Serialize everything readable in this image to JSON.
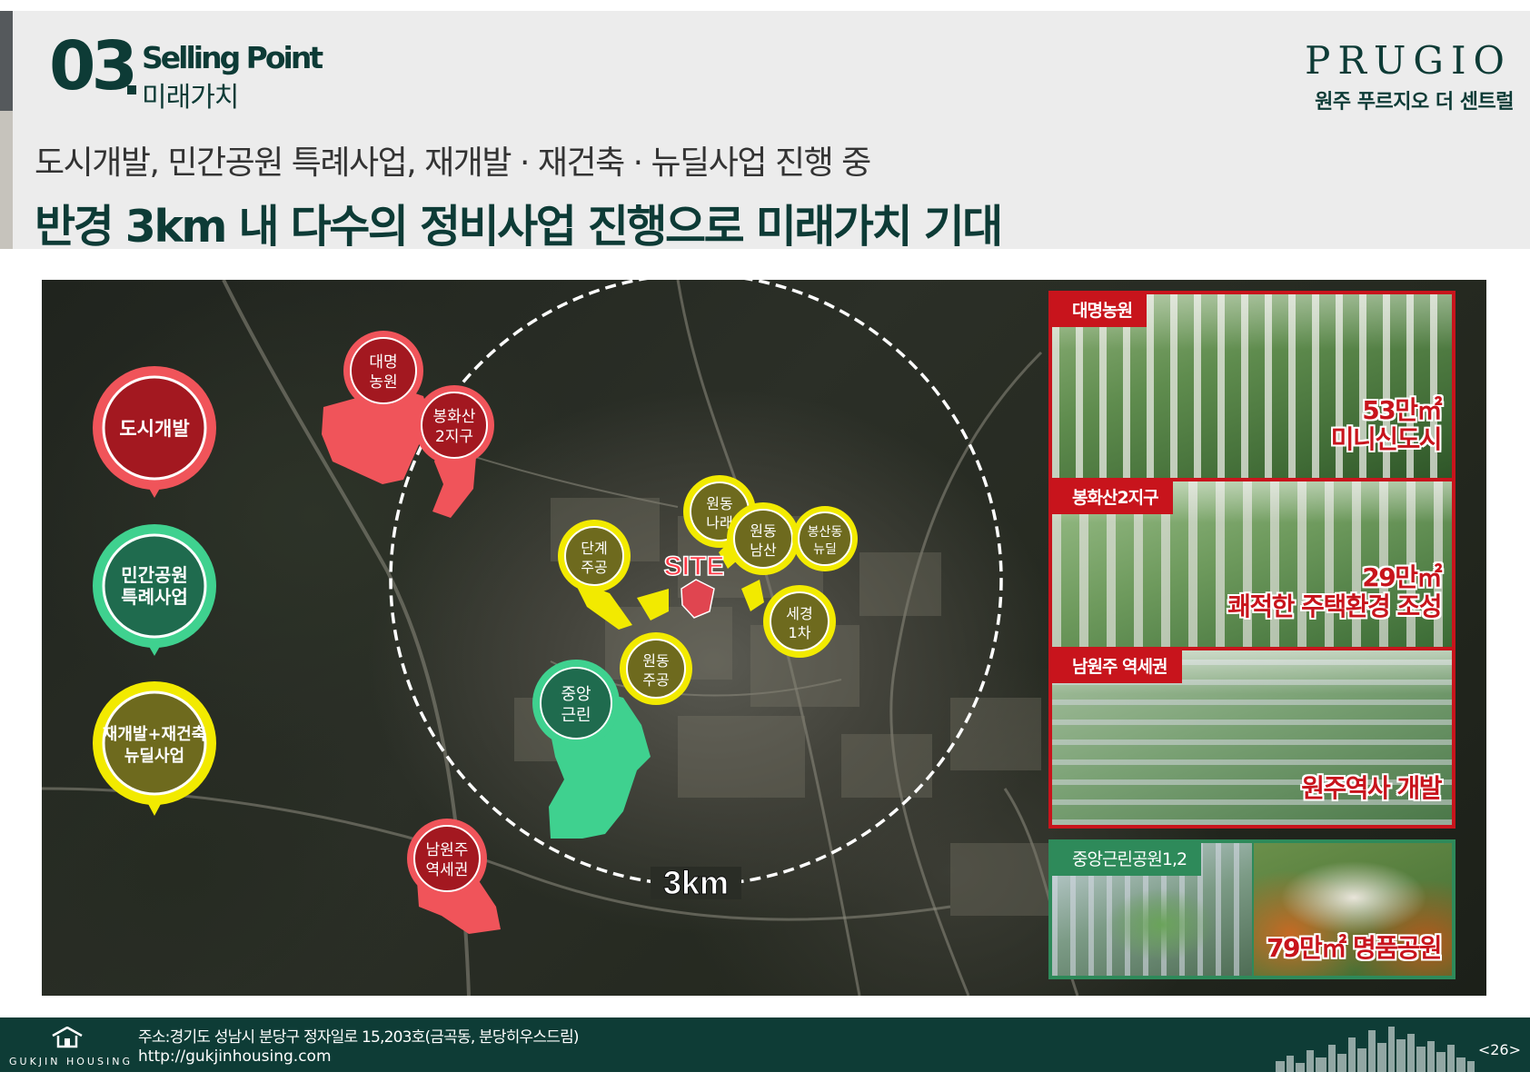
{
  "header": {
    "section_number": "03",
    "section_en": "Selling Point",
    "section_ko": "미래가치",
    "brand": "PRUGIO",
    "brand_sub": "원주 푸르지오 더 센트럴",
    "subtitle": "도시개발, 민간공원 특례사업, 재개발 · 재건축 · 뉴딜사업 진행 중",
    "headline": "반경 3km 내 다수의 정비사업 진행으로 미래가치 기대"
  },
  "legend": [
    {
      "label_lines": [
        "도시개발"
      ],
      "color": "#a31820"
    },
    {
      "label_lines": [
        "민간공원",
        "특례사업"
      ],
      "color": "#1f6b4e"
    },
    {
      "label_lines": [
        "재개발+재건축",
        "뉴딜사업"
      ],
      "color": "#6e6a1e"
    }
  ],
  "map": {
    "radius_label": "3km",
    "site_label": "SITE",
    "bubbles": {
      "daemyeong": [
        "대명",
        "농원"
      ],
      "bonghwasan": [
        "봉화산",
        "2지구"
      ],
      "namwonju": [
        "남원주",
        "역세권"
      ],
      "jungang": [
        "중앙",
        "근린"
      ],
      "dangye": [
        "단계",
        "주공"
      ],
      "wondong_narae": [
        "원동",
        "나래"
      ],
      "wondong_namsan": [
        "원동",
        "남산"
      ],
      "bongsandong": [
        "봉산동",
        "뉴딜"
      ],
      "segyeong": [
        "세경",
        "1차"
      ],
      "wondong_jugong": [
        "원동",
        "주공"
      ]
    }
  },
  "panels": [
    {
      "tag": "대명농원",
      "callout_lines": [
        "53만㎡",
        "미니신도시"
      ]
    },
    {
      "tag": "봉화산2지구",
      "callout_lines": [
        "29만㎡",
        "쾌적한 주택환경 조성"
      ]
    },
    {
      "tag": "남원주 역세권",
      "callout_lines": [
        "원주역사 개발"
      ]
    },
    {
      "tag": "중앙근린공원1,2",
      "callout_lines": [
        "79만㎡ 명품공원"
      ]
    }
  ],
  "footer": {
    "logo_text": "GUKJIN HOUSING",
    "address": "주소:경기도 성남시 분당구 정자일로 15,203호(금곡동, 분당히우스드림)",
    "url": "http://gukjinhousing.com",
    "page": "<26>"
  },
  "colors": {
    "primary": "#0d3b36",
    "red": "#c8141c",
    "green": "#2e8a5a",
    "yellow": "#f2ea00",
    "mint": "#3fd18f",
    "coral": "#f0545a"
  }
}
